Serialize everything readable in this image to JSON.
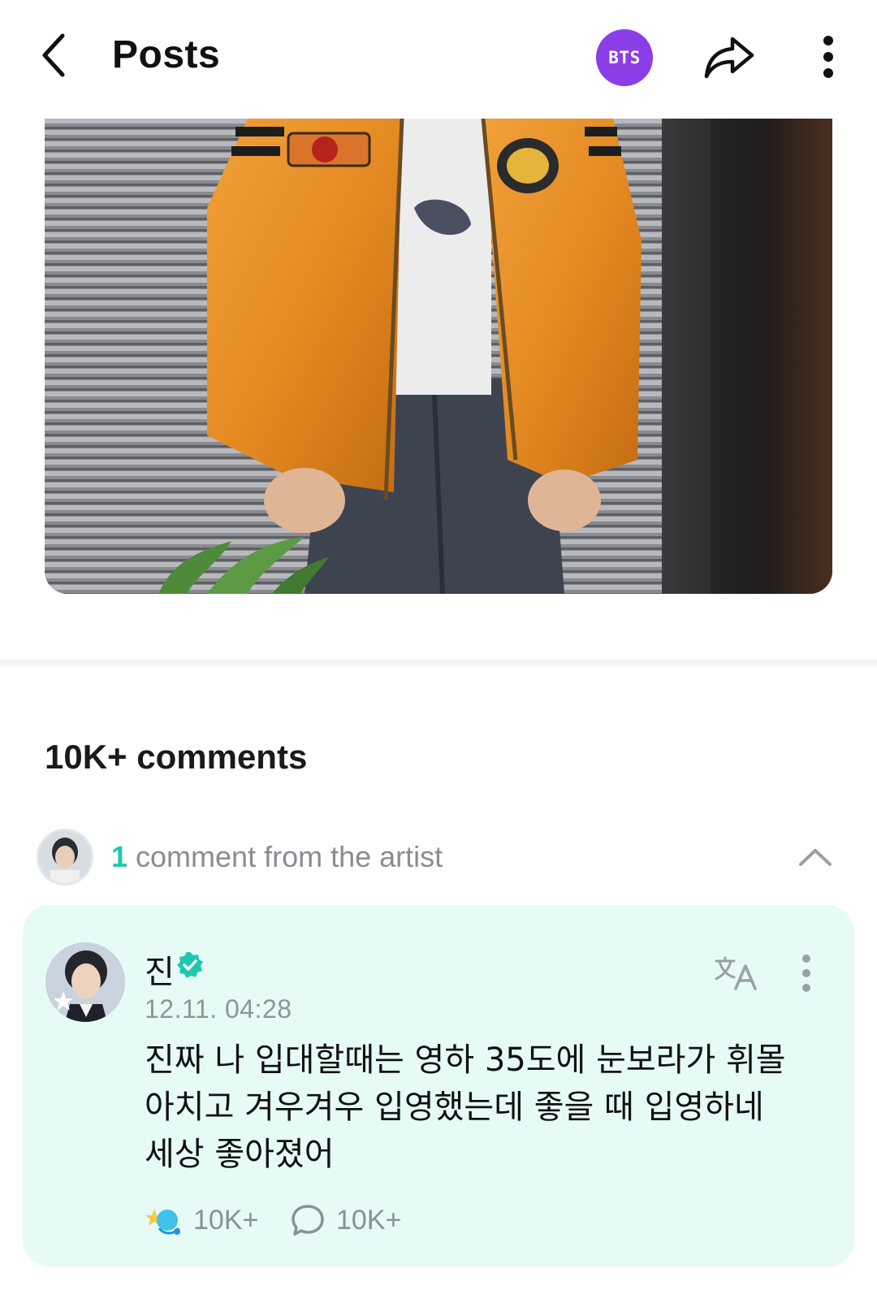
{
  "header": {
    "title": "Posts",
    "community_badge": "BTS",
    "accent": "#8b3ee8",
    "icons": [
      "back-arrow-icon",
      "share-icon",
      "more-vertical-icon"
    ]
  },
  "comments": {
    "count_label": "10K+ comments",
    "artist_summary": {
      "count": "1",
      "label": "comment from the artist",
      "accent": "#1ec7b0"
    },
    "artist_comment": {
      "author": "진",
      "timestamp": "12.11. 04:28",
      "lines": [
        "진짜 나 입대할때는 영하 35도에 눈보라가 휘몰",
        "아치고 겨우겨우 입영했는데 좋을 때 입영하네",
        "세상 좋아졌어"
      ],
      "reactions": "10K+",
      "replies": "10K+",
      "card_color": "#e6fbf6"
    }
  }
}
